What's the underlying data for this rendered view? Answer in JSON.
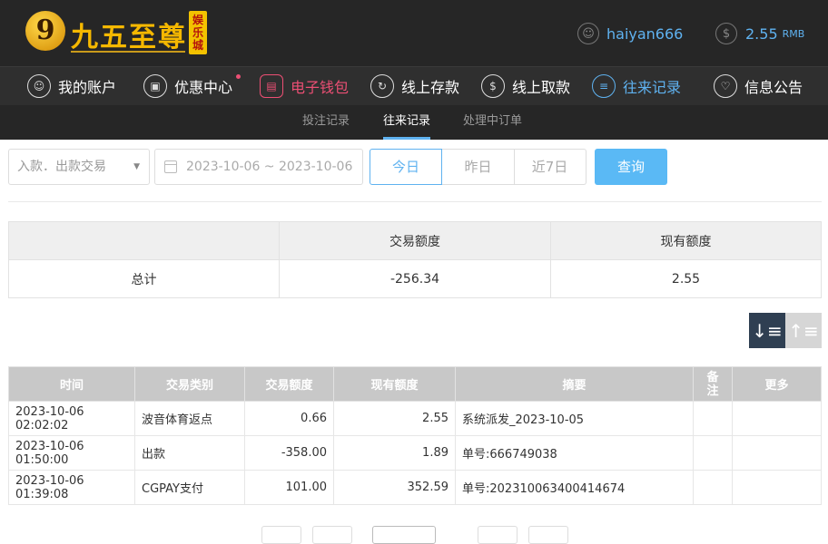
{
  "brand": {
    "logo_mark": "9",
    "logo_text": "九五至尊",
    "logo_tag": "娱乐城"
  },
  "user": {
    "username": "haiyan666",
    "user_icon": "person-icon",
    "balance": "2.55",
    "currency": "RMB",
    "balance_icon": "dollar-icon"
  },
  "nav": {
    "items": [
      {
        "label": "我的账户",
        "icon": "person-icon"
      },
      {
        "label": "优惠中心",
        "icon": "gift-icon"
      },
      {
        "label": "电子钱包",
        "icon": "wallet-icon"
      },
      {
        "label": "线上存款",
        "icon": "deposit-icon"
      },
      {
        "label": "线上取款",
        "icon": "withdraw-icon"
      },
      {
        "label": "往来记录",
        "icon": "records-icon"
      },
      {
        "label": "信息公告",
        "icon": "bell-icon"
      }
    ]
  },
  "subnav": {
    "items": [
      "投注记录",
      "往来记录",
      "处理中订单"
    ],
    "active": "往来记录"
  },
  "filters": {
    "type_placeholder": "入款．出款交易",
    "date_range": "2023-10-06 ~ 2023-10-06",
    "ranges": [
      "今日",
      "昨日",
      "近7日"
    ],
    "active_range": "今日",
    "query_label": "查询"
  },
  "summary": {
    "headers": [
      "",
      "交易额度",
      "现有额度"
    ],
    "row": {
      "label": "总计",
      "amount": "-256.34",
      "current": "2.55"
    }
  },
  "table": {
    "headers": [
      "时间",
      "交易类别",
      "交易额度",
      "现有额度",
      "摘要",
      "备\n注",
      "更多"
    ],
    "rows": [
      {
        "time": "2023-10-06 02:02:02",
        "type": "波音体育返点",
        "amount": "0.66",
        "balance": "2.55",
        "summary": "系统派发_2023-10-05"
      },
      {
        "time": "2023-10-06 01:50:00",
        "type": "出款",
        "amount": "-358.00",
        "balance": "1.89",
        "summary": "单号:666749038"
      },
      {
        "time": "2023-10-06 01:39:08",
        "type": "CGPAY支付",
        "amount": "101.00",
        "balance": "352.59",
        "summary": "单号:202310063400414674"
      }
    ]
  },
  "colors": {
    "accent": "#5fb2f0",
    "pink": "#ec4f74",
    "header_bg": "#262626"
  }
}
